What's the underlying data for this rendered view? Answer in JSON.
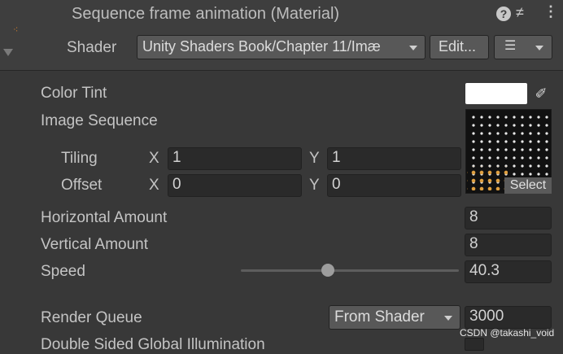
{
  "header": {
    "title": "Sequence frame animation (Material)",
    "shader_label": "Shader",
    "shader_value": "Unity Shaders Book/Chapter 11/Imæ",
    "edit_label": "Edit..."
  },
  "properties": {
    "color_tint": {
      "label": "Color Tint",
      "color": "#ffffff"
    },
    "image_sequence": {
      "label": "Image Sequence",
      "select_label": "Select"
    },
    "tiling": {
      "label": "Tiling",
      "x_label": "X",
      "y_label": "Y",
      "x": "1",
      "y": "1"
    },
    "offset": {
      "label": "Offset",
      "x_label": "X",
      "y_label": "Y",
      "x": "0",
      "y": "0"
    },
    "horizontal_amount": {
      "label": "Horizontal Amount",
      "value": "8"
    },
    "vertical_amount": {
      "label": "Vertical Amount",
      "value": "8"
    },
    "speed": {
      "label": "Speed",
      "value": "40.3",
      "slider_fraction": 0.4
    },
    "render_queue": {
      "label": "Render Queue",
      "mode": "From Shader",
      "value": "3000"
    },
    "double_sided_gi": {
      "label": "Double Sided Global Illumination"
    }
  },
  "icons": [
    "material-icon",
    "help-icon",
    "preset-icon",
    "kebab-menu-icon",
    "list-icon",
    "eyedropper-icon"
  ],
  "watermark": "CSDN @takashi_void"
}
